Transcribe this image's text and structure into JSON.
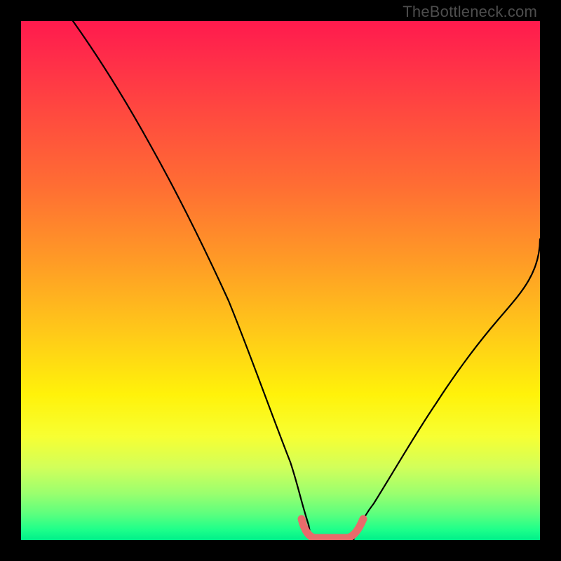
{
  "watermark": "TheBottleneck.com",
  "colors": {
    "background": "#000000",
    "curve_black": "#000000",
    "marker_pink": "#e86b6b",
    "gradient_stops": [
      "#ff1a4d",
      "#ff6e33",
      "#fff20a",
      "#00f08a"
    ]
  },
  "chart_data": {
    "type": "line",
    "title": "",
    "xlabel": "",
    "ylabel": "",
    "xlim": [
      0,
      100
    ],
    "ylim": [
      0,
      100
    ],
    "grid": false,
    "series": [
      {
        "name": "left-curve",
        "x": [
          10,
          15,
          20,
          25,
          30,
          35,
          40,
          45,
          50,
          52,
          54,
          56
        ],
        "y": [
          100,
          93,
          85,
          76,
          66,
          55,
          43,
          30,
          15,
          8,
          3,
          0
        ]
      },
      {
        "name": "right-curve",
        "x": [
          64,
          66,
          68,
          72,
          76,
          80,
          84,
          88,
          92,
          96,
          100
        ],
        "y": [
          0,
          3,
          6,
          12,
          19,
          26,
          33,
          40,
          47,
          53,
          58
        ]
      },
      {
        "name": "bottom-marker",
        "x": [
          54,
          56,
          58,
          60,
          62,
          64,
          66
        ],
        "y": [
          4,
          1,
          0,
          0,
          0,
          1,
          4
        ]
      }
    ],
    "annotations": []
  }
}
